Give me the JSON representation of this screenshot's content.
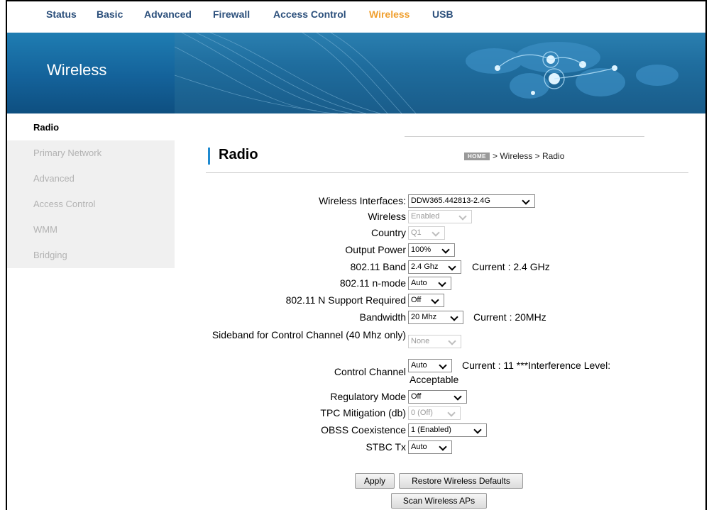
{
  "nav": {
    "items": [
      "Status",
      "Basic",
      "Advanced",
      "Firewall",
      "Access Control",
      "Wireless",
      "USB"
    ],
    "active": "Wireless"
  },
  "banner": {
    "title": "Wireless"
  },
  "sidebar": {
    "items": [
      "Radio",
      "Primary Network",
      "Advanced",
      "Access Control",
      "WMM",
      "Bridging"
    ],
    "active": "Radio"
  },
  "page": {
    "title": "Radio",
    "breadcrumb": {
      "home": "HOME",
      "path": "> Wireless > Radio"
    }
  },
  "form": {
    "wireless_interfaces": {
      "label": "Wireless Interfaces:",
      "value": "DDW365.442813-2.4G"
    },
    "wireless": {
      "label": "Wireless",
      "value": "Enabled"
    },
    "country": {
      "label": "Country",
      "value": "Q1"
    },
    "output_power": {
      "label": "Output Power",
      "value": "100%"
    },
    "band": {
      "label": "802.11 Band",
      "value": "2.4 Ghz",
      "current": "Current :  2.4 GHz"
    },
    "n_mode": {
      "label": "802.11 n-mode",
      "value": "Auto"
    },
    "n_support_required": {
      "label": "802.11 N Support Required",
      "value": "Off"
    },
    "bandwidth": {
      "label": "Bandwidth",
      "value": "20 Mhz",
      "current": "Current :  20MHz"
    },
    "sideband": {
      "label": "Sideband for Control Channel (40 Mhz only)",
      "value": "None"
    },
    "control_channel": {
      "label": "Control Channel",
      "value": "Auto",
      "current": "Current :  11 ***Interference Level:",
      "current2": "Acceptable"
    },
    "regulatory_mode": {
      "label": "Regulatory Mode",
      "value": "Off"
    },
    "tpc_mitigation": {
      "label": "TPC Mitigation (db)",
      "value": "0 (Off)"
    },
    "obss_coexistence": {
      "label": "OBSS Coexistence",
      "value": "1 (Enabled)"
    },
    "stbc_tx": {
      "label": "STBC Tx",
      "value": "Auto"
    }
  },
  "buttons": {
    "apply": "Apply",
    "restore": "Restore Wireless Defaults",
    "scan": "Scan Wireless APs"
  },
  "colors": {
    "nav_text": "#2b4f7b",
    "nav_active": "#f0a030",
    "accent": "#1f8ad0"
  }
}
